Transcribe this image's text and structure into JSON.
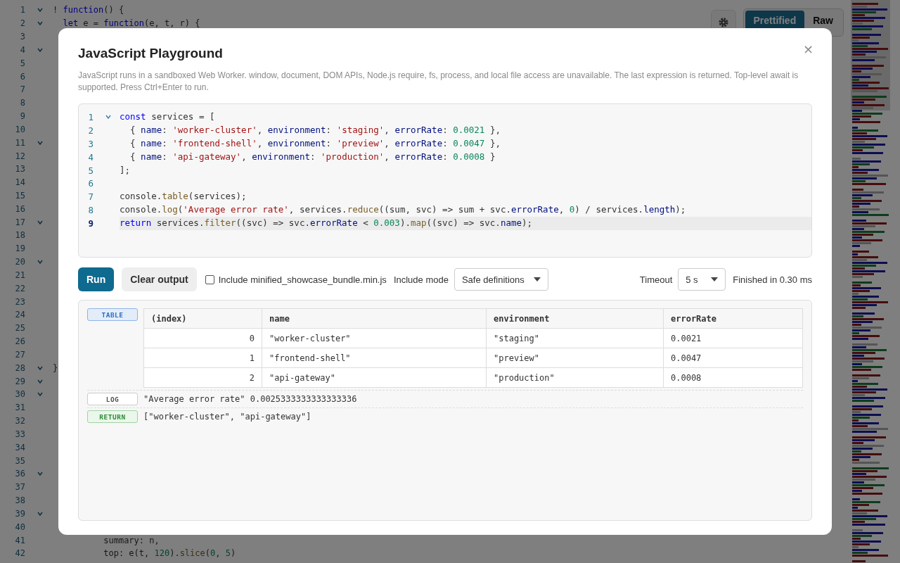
{
  "background_editor": {
    "lines": [
      {
        "n": "1",
        "fold": true,
        "tokens": [
          {
            "text": "!",
            "kind": "plain"
          },
          {
            "text": " function",
            "kind": "kw"
          },
          {
            "text": "() {",
            "kind": "plain"
          }
        ]
      },
      {
        "n": "2",
        "fold": true,
        "tokens": [
          {
            "text": "  let",
            "kind": "kw"
          },
          {
            "text": " e = ",
            "kind": "plain"
          },
          {
            "text": "function",
            "kind": "kw"
          },
          {
            "text": "(e, t, r) {",
            "kind": "plain"
          }
        ]
      },
      {
        "n": "3",
        "fold": false
      },
      {
        "n": "4",
        "fold": true
      },
      {
        "n": "5",
        "fold": false
      },
      {
        "n": "6",
        "fold": false
      },
      {
        "n": "7",
        "fold": false
      },
      {
        "n": "8",
        "fold": false
      },
      {
        "n": "9",
        "fold": false
      },
      {
        "n": "10",
        "fold": false
      },
      {
        "n": "11",
        "fold": true
      },
      {
        "n": "12",
        "fold": false
      },
      {
        "n": "13",
        "fold": false
      },
      {
        "n": "14",
        "fold": false
      },
      {
        "n": "15",
        "fold": false
      },
      {
        "n": "16",
        "fold": false
      },
      {
        "n": "17",
        "fold": true
      },
      {
        "n": "18",
        "fold": false
      },
      {
        "n": "19",
        "fold": false
      },
      {
        "n": "20",
        "fold": true
      },
      {
        "n": "21",
        "fold": false
      },
      {
        "n": "22",
        "fold": false
      },
      {
        "n": "23",
        "fold": false
      },
      {
        "n": "24",
        "fold": false
      },
      {
        "n": "25",
        "fold": false
      },
      {
        "n": "26",
        "fold": false
      },
      {
        "n": "27",
        "fold": false
      },
      {
        "n": "28",
        "fold": true,
        "tokens": [
          {
            "text": "}",
            "kind": "plain"
          }
        ]
      },
      {
        "n": "29",
        "fold": true
      },
      {
        "n": "30",
        "fold": true
      },
      {
        "n": "31",
        "fold": false
      },
      {
        "n": "32",
        "fold": false
      },
      {
        "n": "33",
        "fold": false
      },
      {
        "n": "34",
        "fold": false
      },
      {
        "n": "35",
        "fold": false
      },
      {
        "n": "36",
        "fold": true
      },
      {
        "n": "37",
        "fold": false
      },
      {
        "n": "38",
        "fold": false
      },
      {
        "n": "39",
        "fold": true
      },
      {
        "n": "40",
        "fold": false
      },
      {
        "n": "41",
        "fold": false,
        "tokens": [
          {
            "text": "          summary: n,",
            "kind": "plain"
          }
        ]
      },
      {
        "n": "42",
        "fold": false,
        "tokens": [
          {
            "text": "          top: e(t, ",
            "kind": "plain"
          },
          {
            "text": "120",
            "kind": "num"
          },
          {
            "text": ").",
            "kind": "plain"
          },
          {
            "text": "slice",
            "kind": "fn"
          },
          {
            "text": "(",
            "kind": "plain"
          },
          {
            "text": "0",
            "kind": "num"
          },
          {
            "text": ", ",
            "kind": "plain"
          },
          {
            "text": "5",
            "kind": "num"
          },
          {
            "text": ")",
            "kind": "plain"
          }
        ]
      }
    ]
  },
  "view_tabs": [
    {
      "label": "Prettified",
      "selected": true
    },
    {
      "label": "Raw",
      "selected": false
    }
  ],
  "modal": {
    "title": "JavaScript Playground",
    "close": "×",
    "description": "JavaScript runs in a sandboxed Web Worker. window, document, DOM APIs, Node.js require, fs, process, and local file access are unavailable. The last expression is returned. Top-level await is supported. Press Ctrl+Enter to run.",
    "editor": {
      "lines": [
        {
          "n": "1",
          "fold": true,
          "active": false,
          "tokens": [
            {
              "text": "const",
              "kind": "kw"
            },
            {
              "text": " services = [",
              "kind": "plain"
            }
          ]
        },
        {
          "n": "2",
          "fold": false,
          "active": false,
          "tokens": [
            {
              "text": "  { ",
              "kind": "plain"
            },
            {
              "text": "name",
              "kind": "prop"
            },
            {
              "text": ": ",
              "kind": "plain"
            },
            {
              "text": "'worker-cluster'",
              "kind": "str"
            },
            {
              "text": ", ",
              "kind": "plain"
            },
            {
              "text": "environment",
              "kind": "prop"
            },
            {
              "text": ": ",
              "kind": "plain"
            },
            {
              "text": "'staging'",
              "kind": "str"
            },
            {
              "text": ", ",
              "kind": "plain"
            },
            {
              "text": "errorRate",
              "kind": "prop"
            },
            {
              "text": ": ",
              "kind": "plain"
            },
            {
              "text": "0.0021",
              "kind": "num"
            },
            {
              "text": " },",
              "kind": "plain"
            }
          ]
        },
        {
          "n": "3",
          "fold": false,
          "active": false,
          "tokens": [
            {
              "text": "  { ",
              "kind": "plain"
            },
            {
              "text": "name",
              "kind": "prop"
            },
            {
              "text": ": ",
              "kind": "plain"
            },
            {
              "text": "'frontend-shell'",
              "kind": "str"
            },
            {
              "text": ", ",
              "kind": "plain"
            },
            {
              "text": "environment",
              "kind": "prop"
            },
            {
              "text": ": ",
              "kind": "plain"
            },
            {
              "text": "'preview'",
              "kind": "str"
            },
            {
              "text": ", ",
              "kind": "plain"
            },
            {
              "text": "errorRate",
              "kind": "prop"
            },
            {
              "text": ": ",
              "kind": "plain"
            },
            {
              "text": "0.0047",
              "kind": "num"
            },
            {
              "text": " },",
              "kind": "plain"
            }
          ]
        },
        {
          "n": "4",
          "fold": false,
          "active": false,
          "tokens": [
            {
              "text": "  { ",
              "kind": "plain"
            },
            {
              "text": "name",
              "kind": "prop"
            },
            {
              "text": ": ",
              "kind": "plain"
            },
            {
              "text": "'api-gateway'",
              "kind": "str"
            },
            {
              "text": ", ",
              "kind": "plain"
            },
            {
              "text": "environment",
              "kind": "prop"
            },
            {
              "text": ": ",
              "kind": "plain"
            },
            {
              "text": "'production'",
              "kind": "str"
            },
            {
              "text": ", ",
              "kind": "plain"
            },
            {
              "text": "errorRate",
              "kind": "prop"
            },
            {
              "text": ": ",
              "kind": "plain"
            },
            {
              "text": "0.0008",
              "kind": "num"
            },
            {
              "text": " }",
              "kind": "plain"
            }
          ]
        },
        {
          "n": "5",
          "fold": false,
          "active": false,
          "tokens": [
            {
              "text": "];",
              "kind": "plain"
            }
          ]
        },
        {
          "n": "6",
          "fold": false,
          "active": false
        },
        {
          "n": "7",
          "fold": false,
          "active": false,
          "tokens": [
            {
              "text": "console.",
              "kind": "plain"
            },
            {
              "text": "table",
              "kind": "fn"
            },
            {
              "text": "(services);",
              "kind": "plain"
            }
          ]
        },
        {
          "n": "8",
          "fold": false,
          "active": false,
          "tokens": [
            {
              "text": "console.",
              "kind": "plain"
            },
            {
              "text": "log",
              "kind": "fn"
            },
            {
              "text": "(",
              "kind": "plain"
            },
            {
              "text": "'Average error rate'",
              "kind": "str"
            },
            {
              "text": ", services.",
              "kind": "plain"
            },
            {
              "text": "reduce",
              "kind": "fn"
            },
            {
              "text": "((sum, svc) => sum + svc.",
              "kind": "plain"
            },
            {
              "text": "errorRate",
              "kind": "prop"
            },
            {
              "text": ", ",
              "kind": "plain"
            },
            {
              "text": "0",
              "kind": "num"
            },
            {
              "text": ") / services.",
              "kind": "plain"
            },
            {
              "text": "length",
              "kind": "prop"
            },
            {
              "text": ");",
              "kind": "plain"
            }
          ]
        },
        {
          "n": "9",
          "fold": false,
          "active": true,
          "tokens": [
            {
              "text": "return",
              "kind": "kw"
            },
            {
              "text": " services.",
              "kind": "plain"
            },
            {
              "text": "filter",
              "kind": "fn"
            },
            {
              "text": "((svc) => svc.",
              "kind": "plain"
            },
            {
              "text": "errorRate",
              "kind": "prop"
            },
            {
              "text": " < ",
              "kind": "plain"
            },
            {
              "text": "0.003",
              "kind": "num"
            },
            {
              "text": ").",
              "kind": "plain"
            },
            {
              "text": "map",
              "kind": "fn"
            },
            {
              "text": "((svc) => svc.",
              "kind": "plain"
            },
            {
              "text": "name",
              "kind": "prop"
            },
            {
              "text": ");",
              "kind": "plain"
            }
          ]
        }
      ]
    },
    "controls": {
      "run": "Run",
      "clear": "Clear output",
      "include_checkbox": {
        "label": "Include minified_showcase_bundle.min.js",
        "checked": false
      },
      "include_mode": {
        "label": "Include mode",
        "value": "Safe definitions"
      },
      "timeout": {
        "label": "Timeout",
        "value": "5 s"
      },
      "status": "Finished in 0.30 ms"
    },
    "output": {
      "entries": [
        {
          "kind": "table",
          "badge": "TABLE",
          "columns": [
            "(index)",
            "name",
            "environment",
            "errorRate"
          ],
          "rows": [
            [
              "0",
              "\"worker-cluster\"",
              "\"staging\"",
              "0.0021"
            ],
            [
              "1",
              "\"frontend-shell\"",
              "\"preview\"",
              "0.0047"
            ],
            [
              "2",
              "\"api-gateway\"",
              "\"production\"",
              "0.0008"
            ]
          ]
        },
        {
          "kind": "log",
          "badge": "LOG",
          "text": "\"Average error rate\" 0.0025333333333333336"
        },
        {
          "kind": "return",
          "badge": "RETURN",
          "text": "[\"worker-cluster\", \"api-gateway\"]"
        }
      ]
    }
  }
}
